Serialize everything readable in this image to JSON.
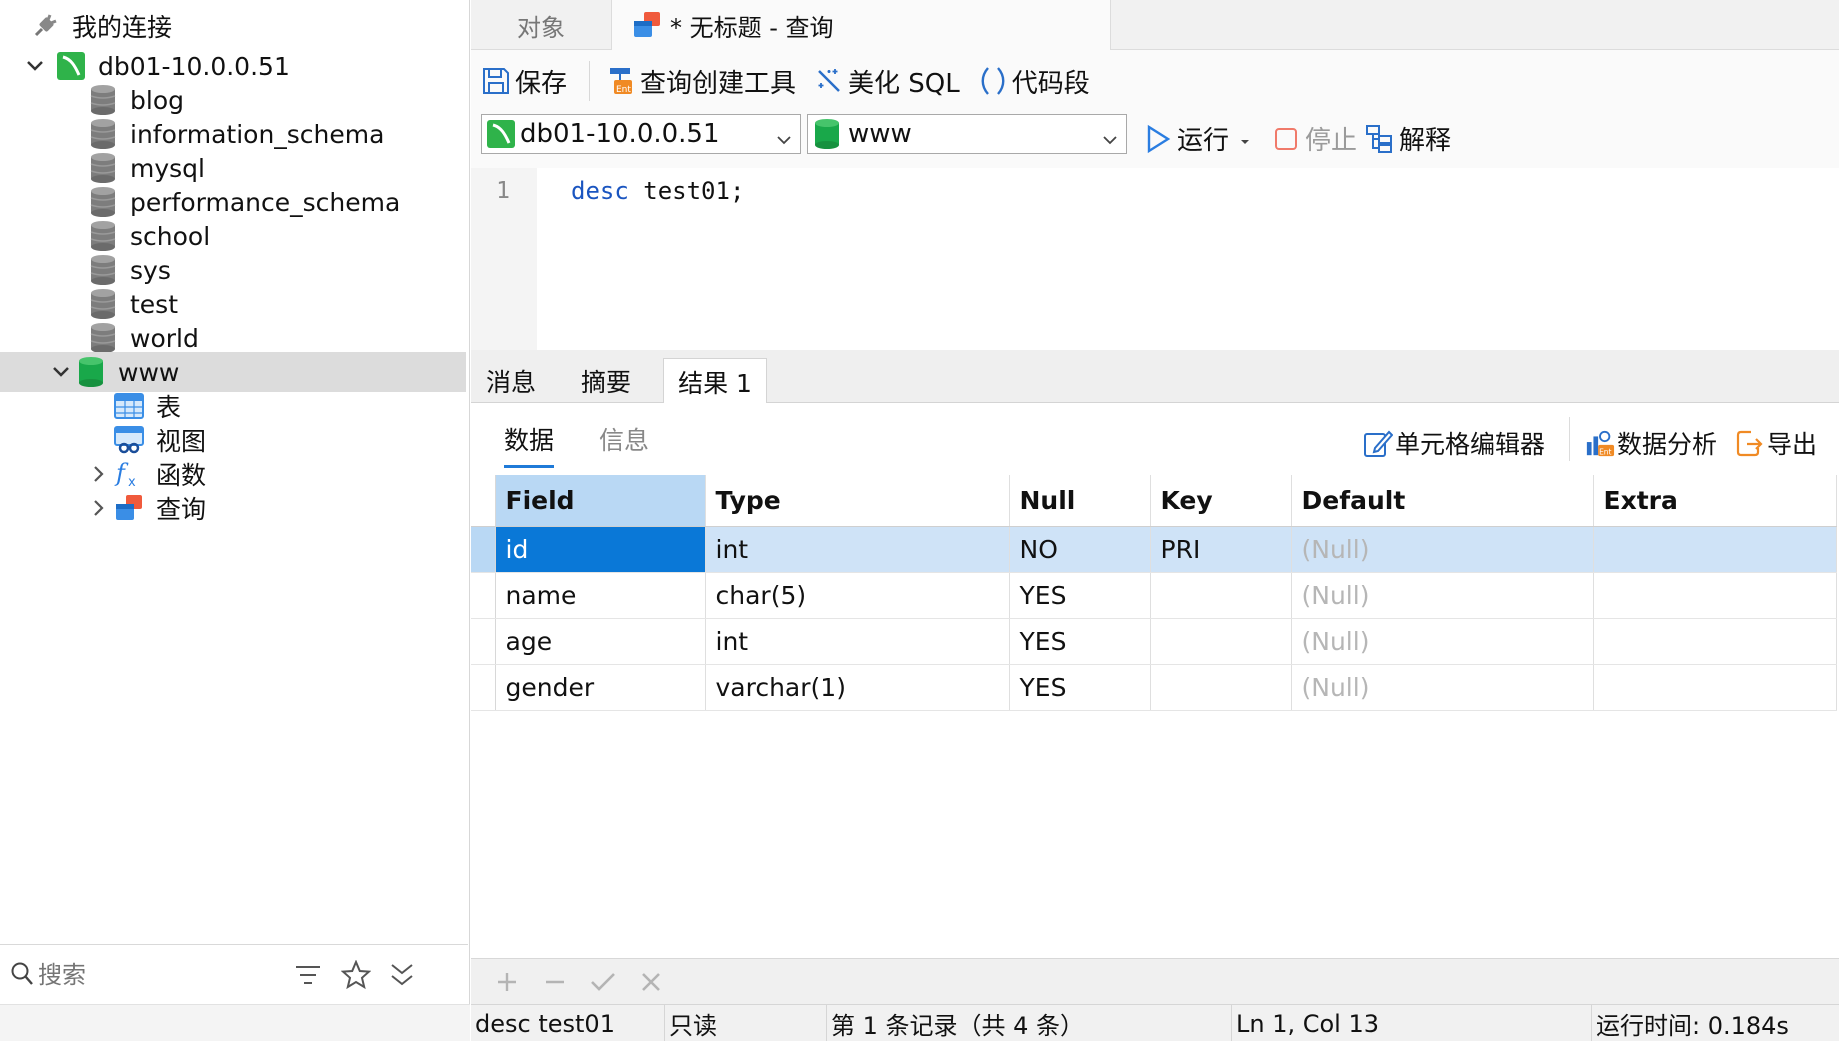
{
  "sidebar": {
    "title": "我的连接",
    "connection": "db01-10.0.0.51",
    "databases": [
      "blog",
      "information_schema",
      "mysql",
      "performance_schema",
      "school",
      "sys",
      "test",
      "world"
    ],
    "selected_db": "www",
    "db_children": [
      "表",
      "视图",
      "函数",
      "查询"
    ],
    "search_placeholder": "搜索"
  },
  "tabs": {
    "objects": "对象",
    "query": "* 无标题 - 查询"
  },
  "toolbar": {
    "save": "保存",
    "query_builder": "查询创建工具",
    "beautify": "美化 SQL",
    "snippet": "代码段",
    "connection": "db01-10.0.0.51",
    "database": "www",
    "run": "运行",
    "stop": "停止",
    "explain": "解释"
  },
  "editor": {
    "line": "1",
    "keyword": "desc",
    "rest": " test01;"
  },
  "result_tabs": [
    "消息",
    "摘要",
    "结果 1"
  ],
  "sub_tabs": [
    "数据",
    "信息"
  ],
  "result_tools": {
    "cell_editor": "单元格编辑器",
    "data_analysis": "数据分析",
    "export": "导出"
  },
  "grid": {
    "columns": [
      "Field",
      "Type",
      "Null",
      "Key",
      "Default",
      "Extra"
    ],
    "rows": [
      [
        "id",
        "int",
        "NO",
        "PRI",
        "(Null)",
        ""
      ],
      [
        "name",
        "char(5)",
        "YES",
        "",
        "(Null)",
        ""
      ],
      [
        "age",
        "int",
        "YES",
        "",
        "(Null)",
        ""
      ],
      [
        "gender",
        "varchar(1)",
        "YES",
        "",
        "(Null)",
        ""
      ]
    ]
  },
  "status": {
    "sql": "desc test01",
    "mode": "只读",
    "record": "第 1 条记录（共 4 条）",
    "cursor": "Ln 1, Col 13",
    "elapsed": "运行时间: 0.184s"
  },
  "colors": {
    "accent": "#0a78d7",
    "selection": "#cfe3f7",
    "connection_green": "#2fb34a"
  }
}
